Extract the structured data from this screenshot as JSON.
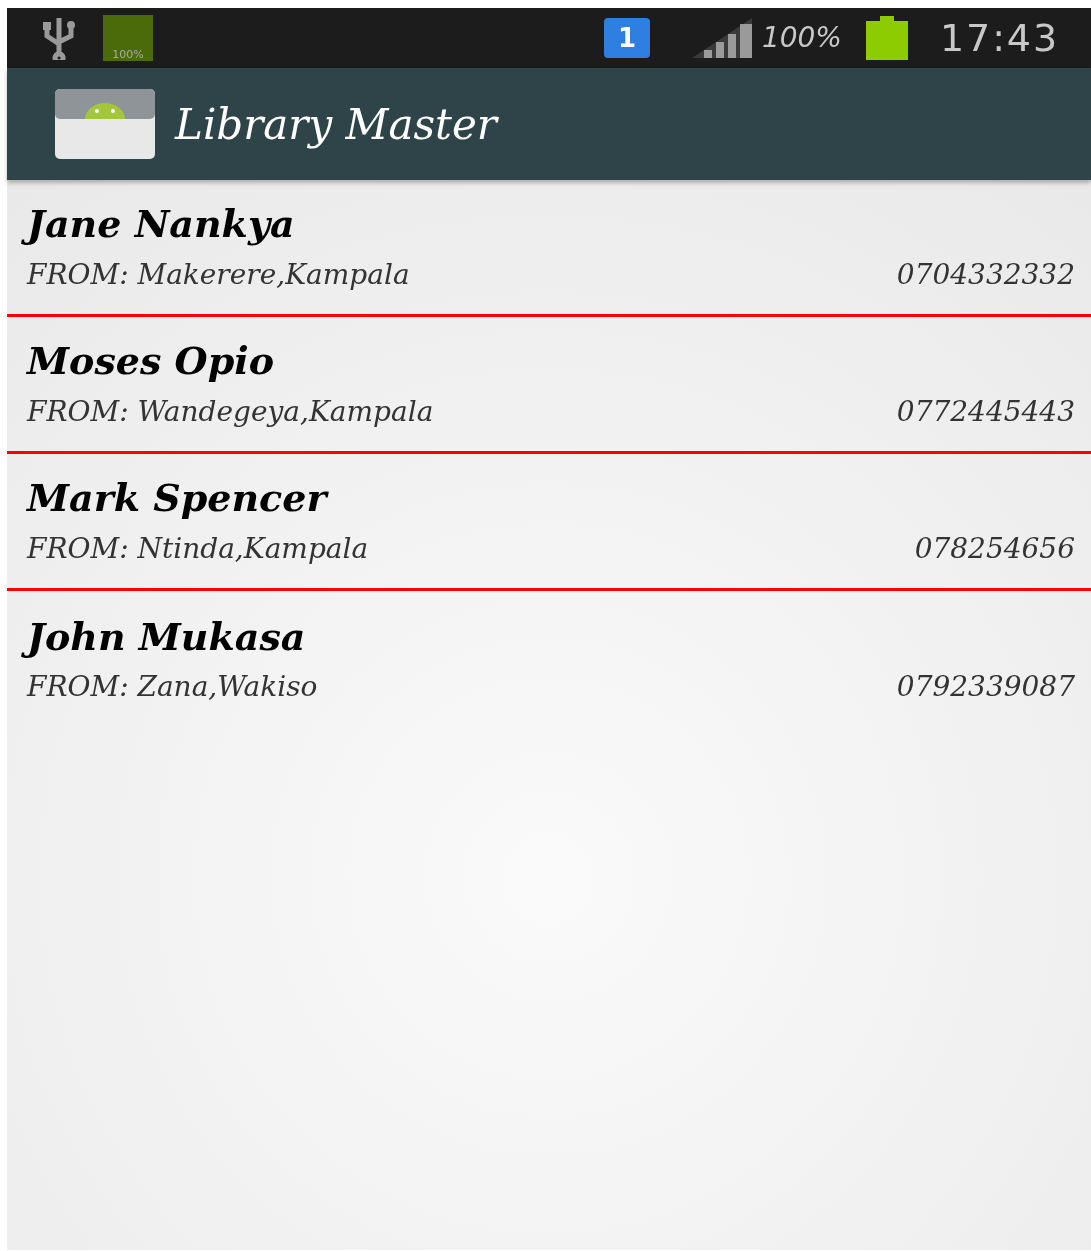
{
  "status_bar": {
    "storage_label": "100%",
    "notification_count": "1",
    "battery_percent": "100%",
    "time": "17:43"
  },
  "action_bar": {
    "title": "Library Master"
  },
  "contacts": [
    {
      "name": "Jane Nankya",
      "from": "FROM: Makerere,Kampala",
      "phone": "0704332332"
    },
    {
      "name": "Moses Opio",
      "from": "FROM: Wandegeya,Kampala",
      "phone": "0772445443"
    },
    {
      "name": "Mark Spencer",
      "from": "FROM: Ntinda,Kampala",
      "phone": "078254656"
    },
    {
      "name": "John Mukasa",
      "from": "FROM: Zana,Wakiso",
      "phone": "0792339087"
    }
  ]
}
